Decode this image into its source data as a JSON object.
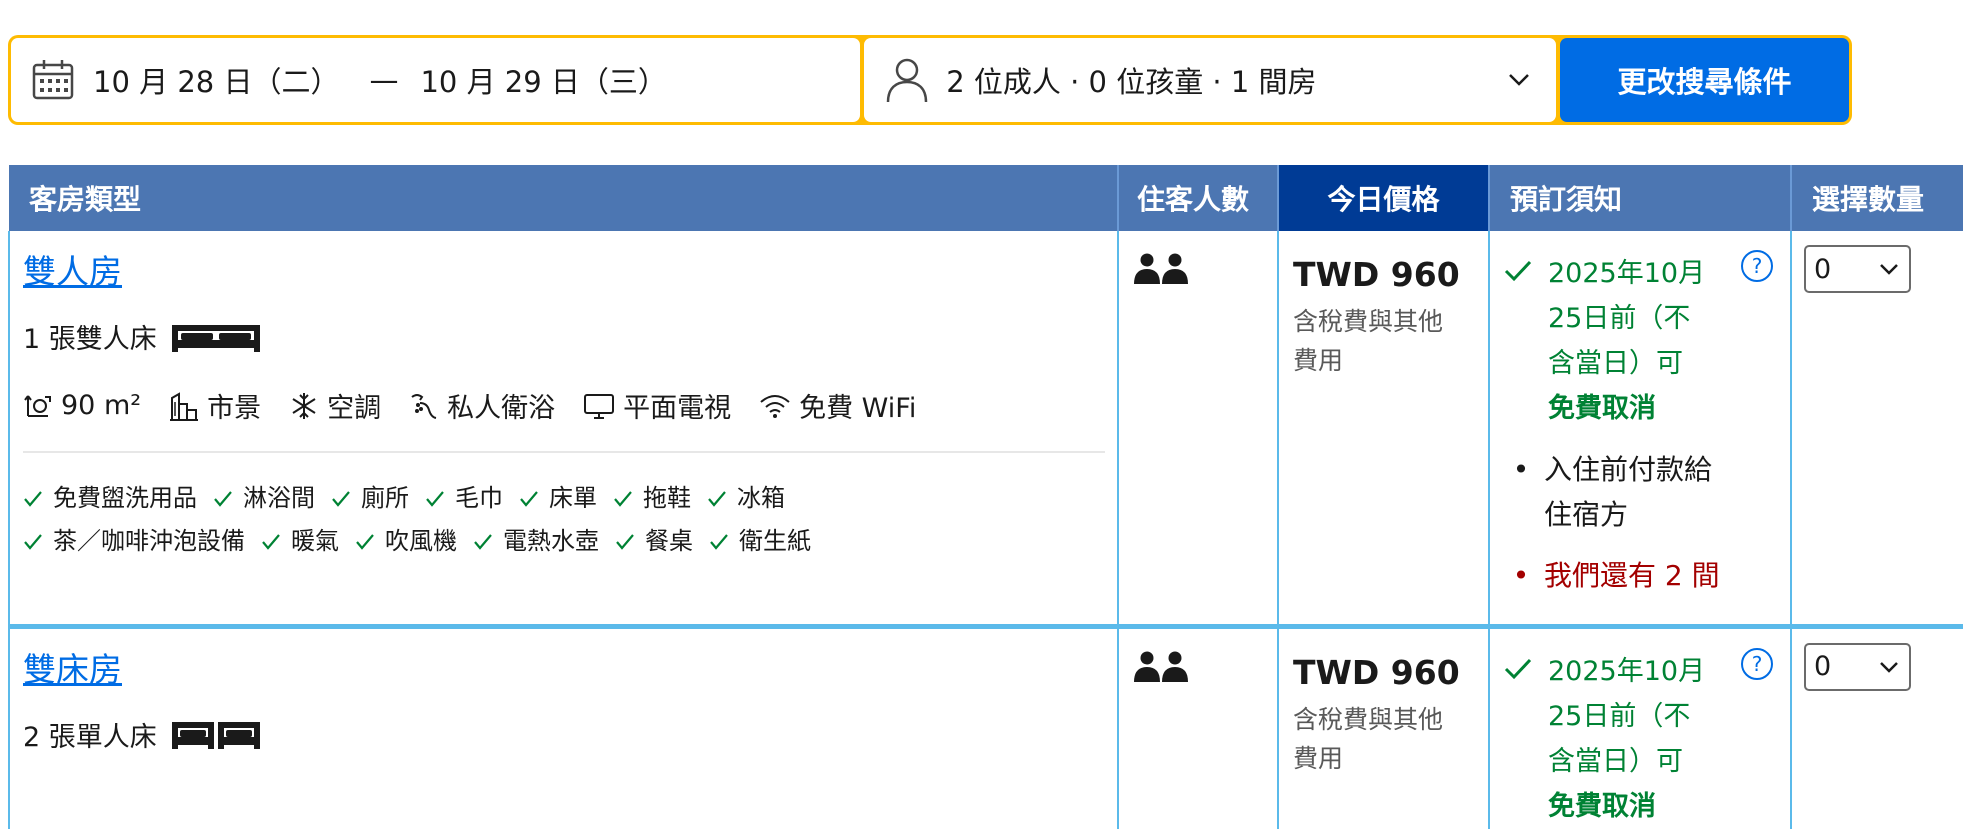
{
  "search": {
    "check_in": "10 月 28 日（二）",
    "date_separator": "—",
    "check_out": "10 月 29 日（三）",
    "guests": "2 位成人 · 0 位孩童 · 1 間房",
    "submit_label": "更改搜尋條件"
  },
  "table": {
    "headers": {
      "room_type": "客房類型",
      "guests": "住客人數",
      "today_price": "今日價格",
      "booking_notes": "預訂須知",
      "select_qty": "選擇數量"
    }
  },
  "rooms": [
    {
      "name": "雙人房",
      "bed": "1 張雙人床",
      "facilities": [
        "90 m²",
        "市景",
        "空調",
        "私人衛浴",
        "平面電視",
        "免費 WiFi"
      ],
      "amenities": [
        "免費盥洗用品",
        "淋浴間",
        "廁所",
        "毛巾",
        "床單",
        "拖鞋",
        "冰箱",
        "茶／咖啡沖泡設備",
        "暖氣",
        "吹風機",
        "電熱水壺",
        "餐桌",
        "衛生紙"
      ],
      "price": "TWD 960",
      "price_note": "含稅費與其他費用",
      "cancel_text": "2025年10月25日前（不含當日）可",
      "cancel_bold": "免費取消",
      "payment_note": "入住前付款給住宿方",
      "scarcity": "我們還有 2 間",
      "qty": "0"
    },
    {
      "name": "雙床房",
      "bed": "2 張單人床",
      "price": "TWD 960",
      "price_note": "含稅費與其他費用",
      "cancel_text": "2025年10月25日前（不含當日）可",
      "cancel_bold": "免費取消",
      "qty": "0"
    }
  ],
  "colors": {
    "accent_yellow": "#febb02",
    "primary_blue": "#006ce4",
    "header_blue": "#4c76b2",
    "header_dark_blue": "#003b95",
    "green": "#008234",
    "red": "#a30000"
  }
}
